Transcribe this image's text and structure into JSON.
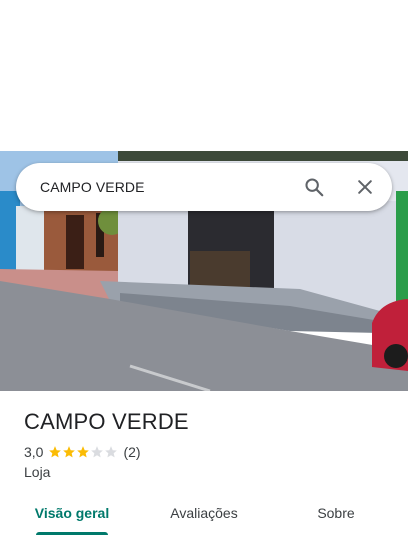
{
  "search": {
    "query": "CAMPO VERDE",
    "search_icon": "search-icon",
    "close_icon": "close-icon"
  },
  "hero_photo": {
    "description_icon": "storefront-photo"
  },
  "place": {
    "name": "CAMPO VERDE",
    "rating": "3,0",
    "rating_value": 3,
    "rating_max": 5,
    "review_count": "(2)",
    "category": "Loja"
  },
  "tabs": [
    {
      "label": "Visão geral",
      "active": true
    },
    {
      "label": "Avaliações",
      "active": false
    },
    {
      "label": "Sobre",
      "active": false
    }
  ],
  "colors": {
    "accent": "#00796b",
    "star_filled": "#fbbc04",
    "star_empty": "#dadce0"
  }
}
